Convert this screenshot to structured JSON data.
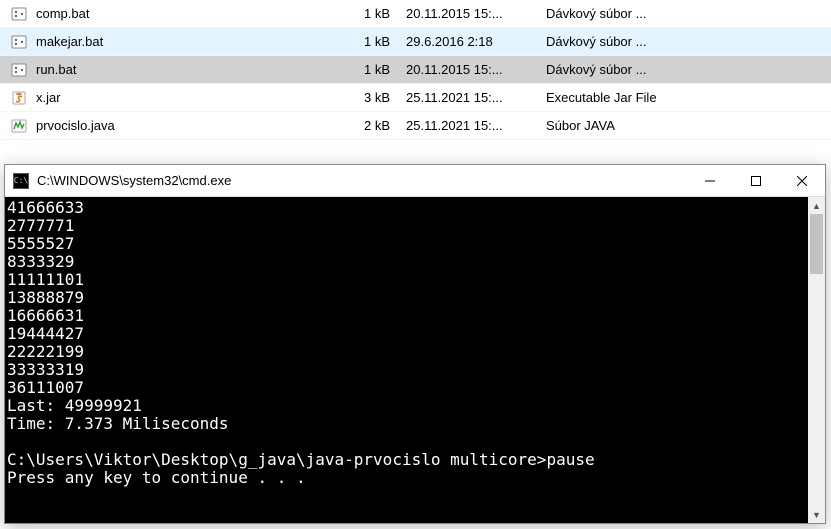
{
  "files": [
    {
      "icon": "bat",
      "name": "comp.bat",
      "size": "1 kB",
      "date": "20.11.2015 15:...",
      "type": "Dávkový súbor ...",
      "state": ""
    },
    {
      "icon": "bat",
      "name": "makejar.bat",
      "size": "1 kB",
      "date": "29.6.2016 2:18",
      "type": "Dávkový súbor ...",
      "state": "highlight"
    },
    {
      "icon": "bat",
      "name": "run.bat",
      "size": "1 kB",
      "date": "20.11.2015 15:...",
      "type": "Dávkový súbor ...",
      "state": "selected"
    },
    {
      "icon": "jar",
      "name": "x.jar",
      "size": "3 kB",
      "date": "25.11.2021 15:...",
      "type": "Executable Jar File",
      "state": ""
    },
    {
      "icon": "java",
      "name": "prvocislo.java",
      "size": "2 kB",
      "date": "25.11.2021 15:...",
      "type": "Súbor JAVA",
      "state": ""
    }
  ],
  "cmd": {
    "title": "C:\\WINDOWS\\system32\\cmd.exe",
    "lines": [
      "41666633",
      "2777771",
      "5555527",
      "8333329",
      "11111101",
      "13888879",
      "16666631",
      "19444427",
      "22222199",
      "33333319",
      "36111007",
      "Last: 49999921",
      "Time: 7.373 Miliseconds",
      "",
      "C:\\Users\\Viktor\\Desktop\\g_java\\java-prvocislo multicore>pause",
      "Press any key to continue . . ."
    ]
  }
}
